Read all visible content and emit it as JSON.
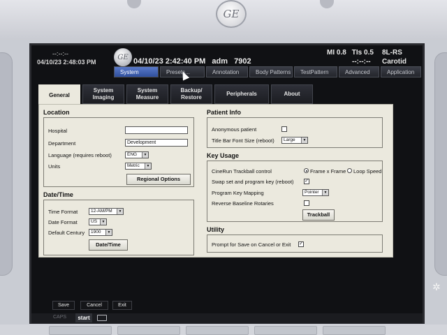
{
  "device": {
    "logo": "GE"
  },
  "header": {
    "clock_top": "--:--:--",
    "clock_datetime": "04/10/23 2:48:03 PM",
    "logo": "GE",
    "exam_date": "04/10/23 2:42:40 PM",
    "user": "adm",
    "exam_id": "7902",
    "mi": "MI 0.8",
    "tis": "TIs 0.5",
    "tis_sub": "--:--:--",
    "probe": "8L-RS",
    "preset": "Carotid"
  },
  "nav": {
    "tabs": [
      "System",
      "Presets...",
      "Annotation",
      "Body Patterns",
      "TestPattern",
      "Advanced",
      "Application"
    ],
    "active": "System"
  },
  "config_tabs": [
    {
      "label": "General",
      "active": true
    },
    {
      "label": "System Imaging"
    },
    {
      "label": "System Measure"
    },
    {
      "label": "Backup/ Restore"
    },
    {
      "label": "Peripherals"
    },
    {
      "label": "About"
    }
  ],
  "location": {
    "title": "Location",
    "hospital_label": "Hospital",
    "hospital_value": "",
    "department_label": "Department",
    "department_value": "Development",
    "language_label": "Language (requires reboot)",
    "language_value": "ENG",
    "units_label": "Units",
    "units_value": "Metric",
    "regional_button": "Regional Options"
  },
  "datetime": {
    "title": "Date/Time",
    "time_format_label": "Time Format",
    "time_format_value": "12-AM/PM",
    "date_format_label": "Date Format",
    "date_format_value": "US",
    "century_label": "Default Century",
    "century_value": "1900",
    "button": "Date/Time"
  },
  "patient_info": {
    "title": "Patient Info",
    "anonymous_label": "Anonymous patient",
    "anonymous_checked": false,
    "titlebar_font_label": "Title Bar Font Size (reboot)",
    "titlebar_font_value": "Large"
  },
  "key_usage": {
    "title": "Key Usage",
    "cinerun_label": "CineRun Trackball control",
    "cinerun_option1": "Frame x Frame",
    "cinerun_option2": "Loop Speed",
    "cinerun_selected": "Frame x Frame",
    "swap_label": "Swap set and program key (reboot)",
    "swap_checked": true,
    "mapping_label": "Program Key Mapping",
    "mapping_value": "Pointer",
    "reverse_label": "Reverse Baseline Rotaries",
    "reverse_checked": false,
    "trackball_button": "Trackball"
  },
  "utility": {
    "title": "Utility",
    "prompt_label": "Prompt for Save on Cancel or Exit",
    "prompt_checked": true
  },
  "footer": {
    "save": "Save",
    "cancel": "Cancel",
    "exit": "Exit",
    "caps": "CAPS",
    "start": "start"
  },
  "check_mark": "✓"
}
